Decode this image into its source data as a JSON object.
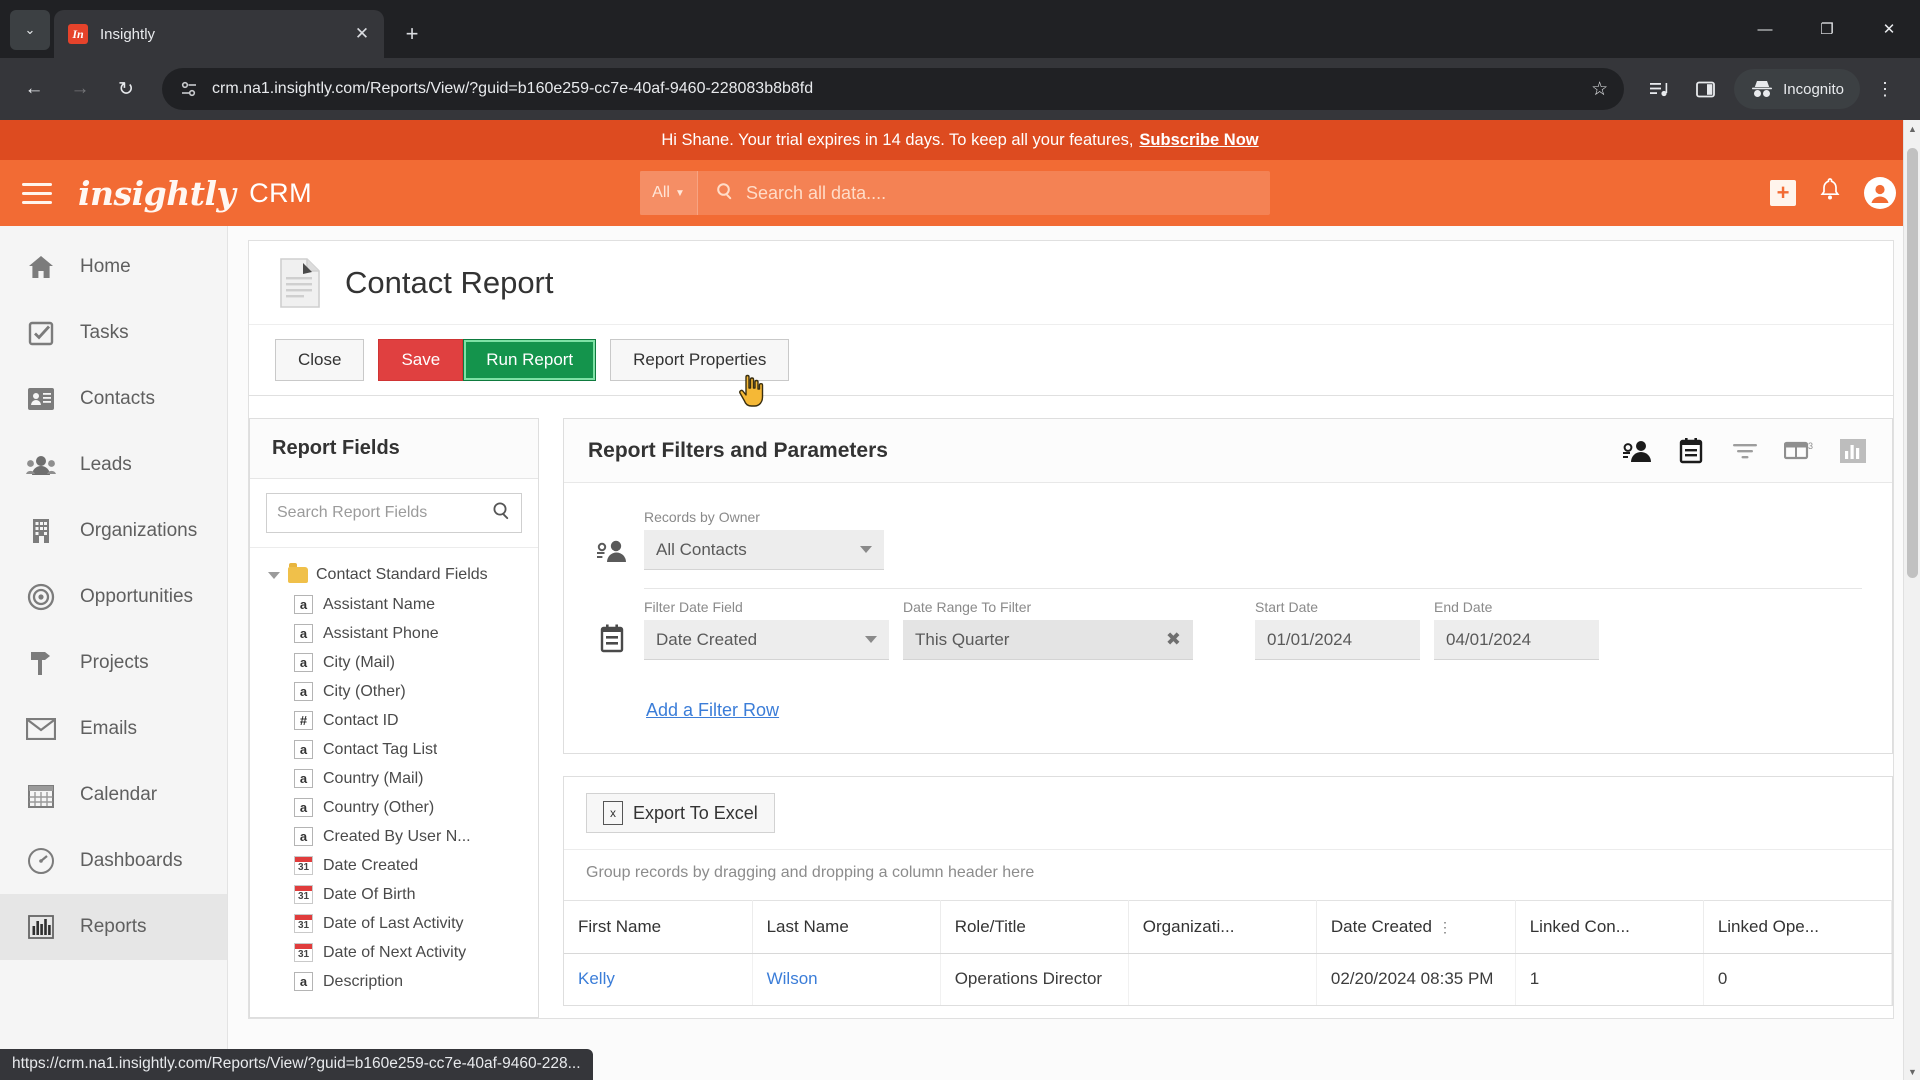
{
  "browser": {
    "tab": {
      "title": "Insightly",
      "favicon_label": "In",
      "close_label": "✕"
    },
    "new_tab_label": "+",
    "tab_list_label": "⌄",
    "window": {
      "minimize": "—",
      "maximize": "❐",
      "close": "✕"
    },
    "nav": {
      "back": "←",
      "forward": "→",
      "reload": "↻"
    },
    "url": "crm.na1.insightly.com/Reports/View/?guid=b160e259-cc7e-40af-9460-228083b8b8fd",
    "star_label": "☆",
    "incognito_label": "Incognito",
    "menu_label": "⋮",
    "status_bubble": "https://crm.na1.insightly.com/Reports/View/?guid=b160e259-cc7e-40af-9460-228..."
  },
  "trial": {
    "message": "Hi Shane. Your trial expires in 14 days. To keep all your features,",
    "cta": "Subscribe Now"
  },
  "header": {
    "logo": "insightly",
    "product": "CRM",
    "search_scope": "All",
    "search_placeholder": "Search all data....",
    "add_label": "+",
    "notifications_label": "🔔",
    "account_label": "👤"
  },
  "sidebar": {
    "items": [
      {
        "label": "Home",
        "icon": "home-icon",
        "active": false
      },
      {
        "label": "Tasks",
        "icon": "tasks-icon",
        "active": false
      },
      {
        "label": "Contacts",
        "icon": "contacts-icon",
        "active": false
      },
      {
        "label": "Leads",
        "icon": "leads-icon",
        "active": false
      },
      {
        "label": "Organizations",
        "icon": "organizations-icon",
        "active": false
      },
      {
        "label": "Opportunities",
        "icon": "opportunities-icon",
        "active": false
      },
      {
        "label": "Projects",
        "icon": "projects-icon",
        "active": false
      },
      {
        "label": "Emails",
        "icon": "emails-icon",
        "active": false
      },
      {
        "label": "Calendar",
        "icon": "calendar-icon",
        "active": false
      },
      {
        "label": "Dashboards",
        "icon": "dashboards-icon",
        "active": false
      },
      {
        "label": "Reports",
        "icon": "reports-icon",
        "active": true
      }
    ]
  },
  "report": {
    "title": "Contact Report",
    "buttons": {
      "close": "Close",
      "save": "Save",
      "run": "Run Report",
      "properties": "Report Properties"
    }
  },
  "report_fields": {
    "panel_title": "Report Fields",
    "search_placeholder": "Search Report Fields",
    "search_value": "",
    "search_icon": "search-icon",
    "root_label": "Contact Standard Fields",
    "items": [
      {
        "label": "Assistant Name",
        "type": "a"
      },
      {
        "label": "Assistant Phone",
        "type": "a"
      },
      {
        "label": "City (Mail)",
        "type": "a"
      },
      {
        "label": "City (Other)",
        "type": "a"
      },
      {
        "label": "Contact ID",
        "type": "#"
      },
      {
        "label": "Contact Tag List",
        "type": "a"
      },
      {
        "label": "Country (Mail)",
        "type": "a"
      },
      {
        "label": "Country (Other)",
        "type": "a"
      },
      {
        "label": "Created By User N...",
        "type": "a"
      },
      {
        "label": "Date Created",
        "type": "31"
      },
      {
        "label": "Date Of Birth",
        "type": "31"
      },
      {
        "label": "Date of Last Activity",
        "type": "31"
      },
      {
        "label": "Date of Next Activity",
        "type": "31"
      },
      {
        "label": "Description",
        "type": "a"
      }
    ]
  },
  "filters": {
    "title": "Report Filters and Parameters",
    "toolbar_icons": [
      "records-by-owner-icon",
      "date-filter-icon",
      "filter-icon",
      "columns-icon",
      "chart-icon"
    ],
    "owner_row": {
      "label": "Records by Owner",
      "value": "All Contacts"
    },
    "date_row": {
      "filter_date_field_label": "Filter Date Field",
      "filter_date_field_value": "Date Created",
      "date_range_label": "Date Range To Filter",
      "date_range_value": "This Quarter",
      "clear_label": "✖",
      "start_date_label": "Start Date",
      "start_date_value": "01/01/2024",
      "end_date_label": "End Date",
      "end_date_value": "04/01/2024"
    },
    "add_filter_row": "Add a Filter Row"
  },
  "grid": {
    "export_label": "Export To Excel",
    "export_icon": "excel-icon",
    "group_hint": "Group records by dragging and dropping a column header here",
    "columns": [
      "First Name",
      "Last Name",
      "Role/Title",
      "Organizati...",
      "Date Created",
      "Linked Con...",
      "Linked Ope..."
    ],
    "sorted_column": "Date Created",
    "rows": [
      {
        "first_name": "Kelly",
        "last_name": "Wilson",
        "role_title": "Operations Director",
        "organization": "",
        "date_created": "02/20/2024 08:35 PM",
        "linked_contacts": "1",
        "linked_opportunities": "0"
      }
    ]
  },
  "colors": {
    "brand_orange": "#f26b34",
    "trial_orange": "#dd4b20",
    "save_red": "#e04040",
    "run_green": "#14944c",
    "link_blue": "#3b7dd8"
  }
}
